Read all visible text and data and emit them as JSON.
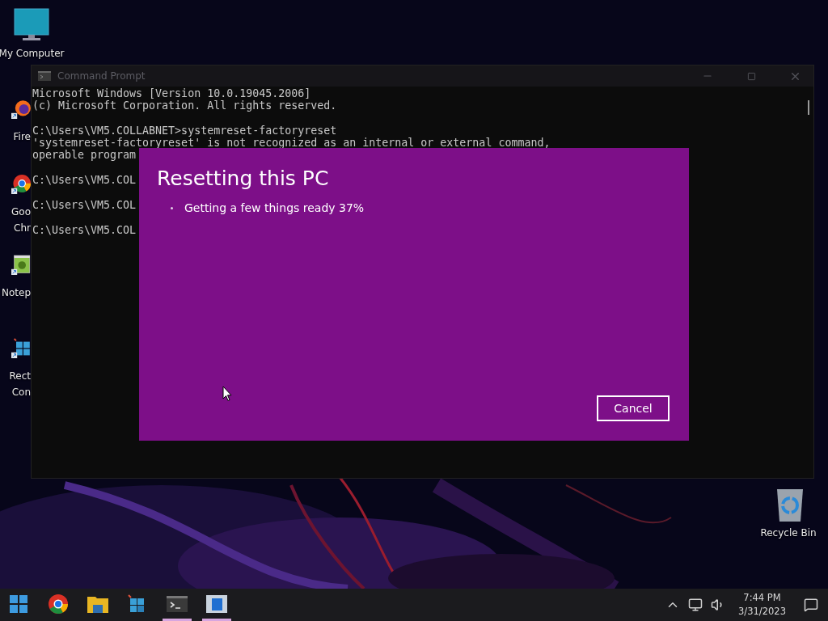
{
  "desktop_icons": [
    {
      "kind": "computer",
      "lines": [
        "My Computer"
      ],
      "covered": false
    },
    {
      "kind": "firefox",
      "lines": [
        "Fire"
      ],
      "covered": true
    },
    {
      "kind": "chrome",
      "lines": [
        "Goo",
        "Chr"
      ],
      "covered": true
    },
    {
      "kind": "notepad",
      "lines": [
        "Notep"
      ],
      "covered": true
    },
    {
      "kind": "remote",
      "lines": [
        "Rect",
        "Con"
      ],
      "covered": true
    },
    {
      "kind": "recycle",
      "lines": [
        "Recycle Bin"
      ],
      "covered": false
    }
  ],
  "cmd_window": {
    "title": "Command Prompt",
    "blocks": [
      [
        "Microsoft Windows [Version 10.0.19045.2006]",
        "(c) Microsoft Corporation. All rights reserved."
      ],
      [
        "C:\\Users\\VM5.COLLABNET>systemreset-factoryreset",
        "'systemreset-factoryreset' is not recognized as an internal or external command,",
        "operable program"
      ],
      [
        "C:\\Users\\VM5.COL"
      ],
      [
        "C:\\Users\\VM5.COL"
      ],
      [
        "C:\\Users\\VM5.COL"
      ]
    ]
  },
  "reset_dialog": {
    "title": "Resetting this PC",
    "steps": [
      "Getting a few things ready 37%"
    ],
    "buttons": [
      "Cancel"
    ]
  },
  "taskbar": {
    "apps": [
      {
        "kind": "start",
        "open": false
      },
      {
        "kind": "chrome",
        "open": false
      },
      {
        "kind": "folder",
        "open": false
      },
      {
        "kind": "remote",
        "open": false
      },
      {
        "kind": "cmd",
        "open": true
      },
      {
        "kind": "window",
        "open": true
      }
    ],
    "time": "7:44 PM",
    "date": "3/31/2023"
  }
}
